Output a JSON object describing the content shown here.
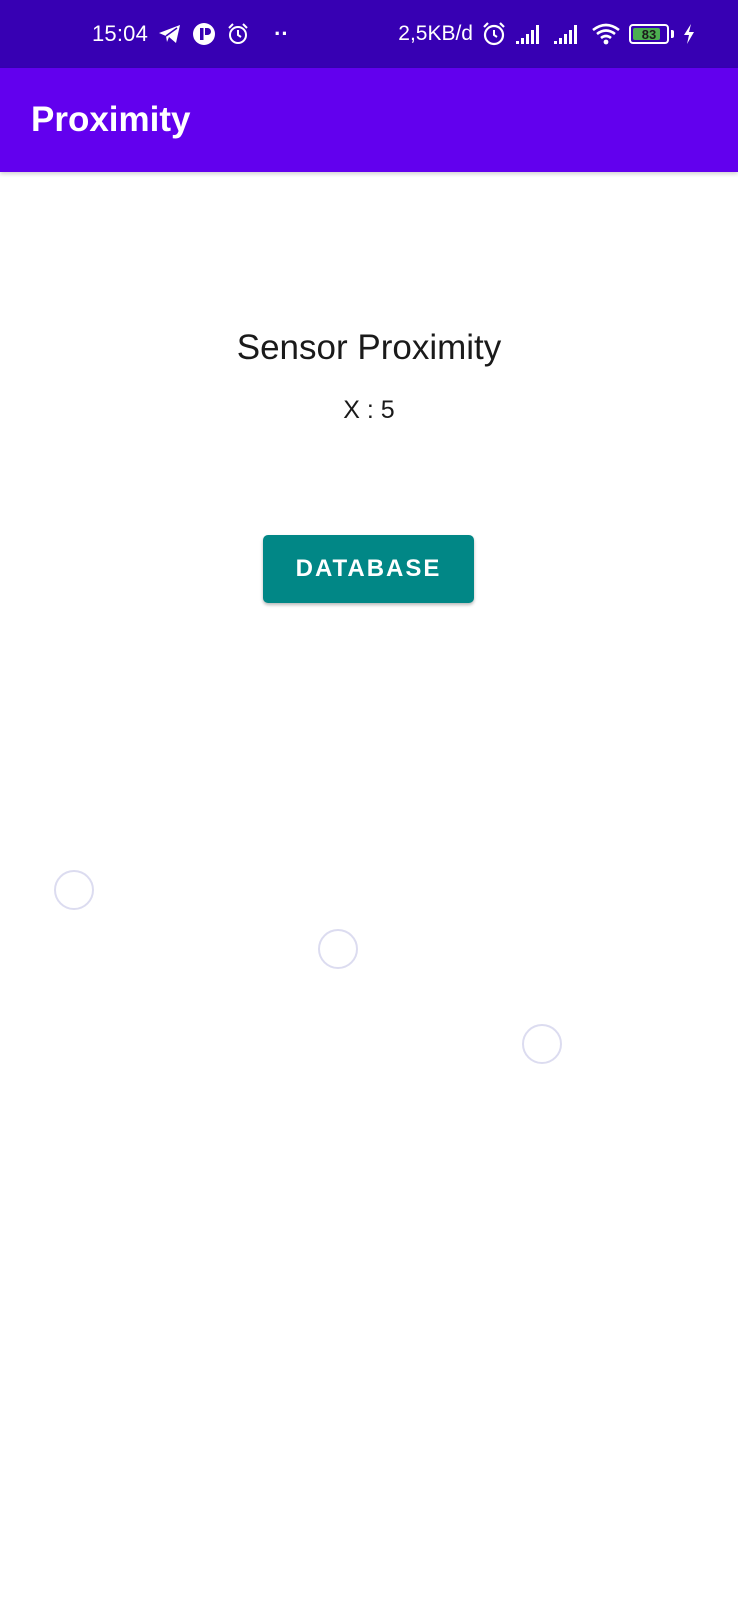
{
  "status_bar": {
    "time": "15:04",
    "network_speed": "2,5KB/d",
    "battery_level": "83",
    "battery_percent": 83,
    "notification_dots": "··",
    "icons": [
      "telegram-icon",
      "app-notification-icon",
      "alarm-icon",
      "more-notifications-icon",
      "alarm-clock-icon",
      "signal-sim1-icon",
      "signal-sim2-icon",
      "wifi-icon",
      "battery-icon",
      "charging-icon"
    ]
  },
  "app_bar": {
    "title": "Proximity"
  },
  "main": {
    "sensor_title": "Sensor Proximity",
    "sensor_value": "X : 5",
    "database_button": "DATABASE"
  },
  "colors": {
    "status_bar": "#3700B3",
    "app_bar": "#6200EE",
    "button": "#018786",
    "battery_fill": "#4CAF50",
    "touch_indicator": "#dcdcf0"
  }
}
